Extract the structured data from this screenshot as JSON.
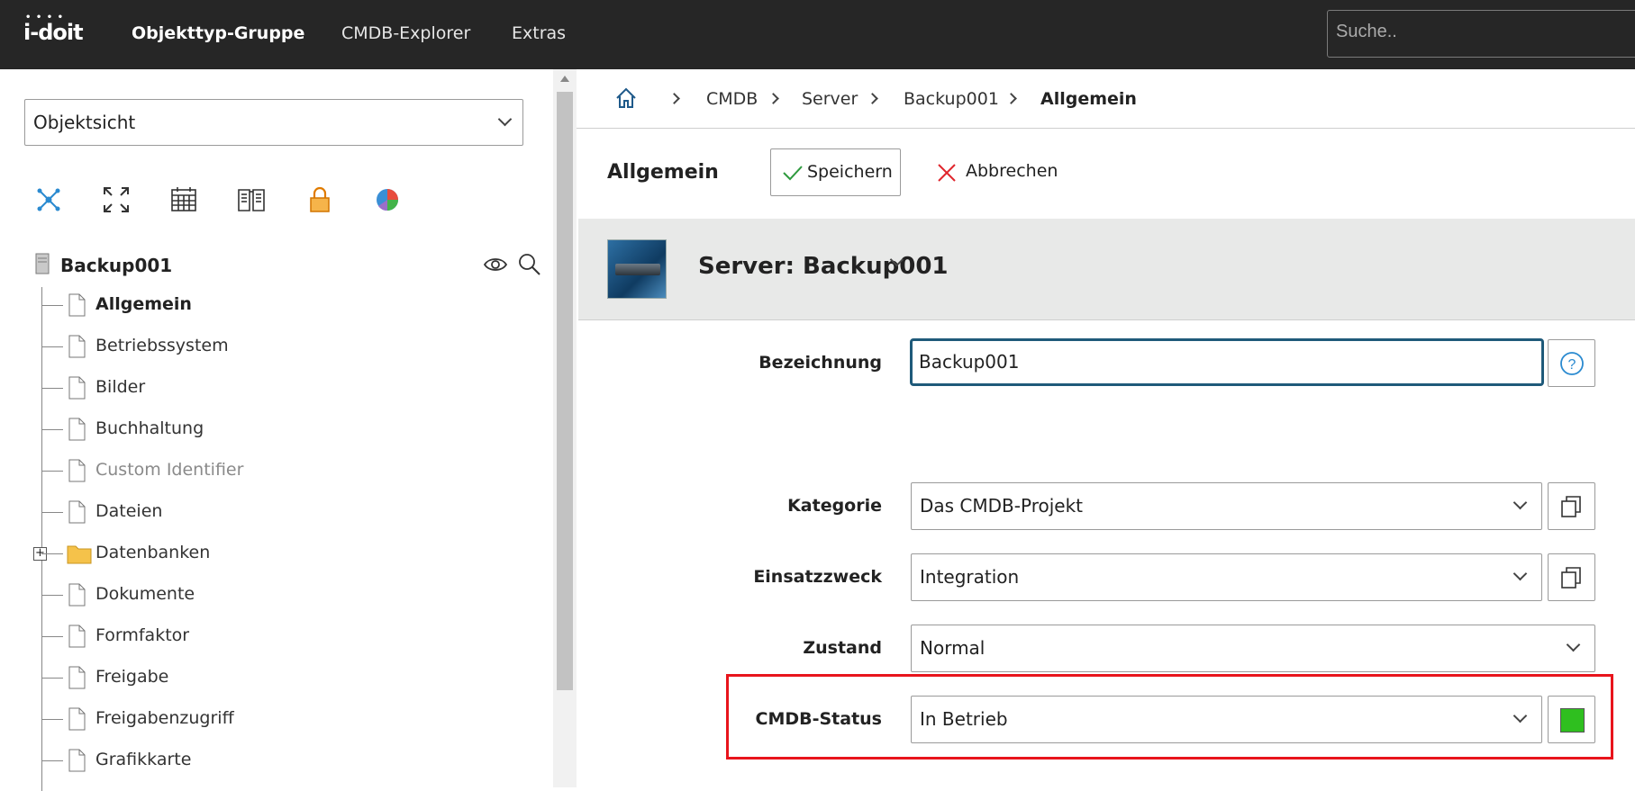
{
  "topbar": {
    "logo": "i-doit",
    "nav": [
      "Objekttyp-Gruppe",
      "CMDB-Explorer",
      "Extras"
    ],
    "search_placeholder": "Suche.."
  },
  "left": {
    "view_select": "Objektsicht",
    "toolbar_icons": [
      "network-icon",
      "expand-icon",
      "calendar-icon",
      "book-icon",
      "lock-icon",
      "pie-chart-icon"
    ],
    "root": "Backup001",
    "items": [
      "Allgemein",
      "Betriebssystem",
      "Bilder",
      "Buchhaltung",
      "Custom Identifier",
      "Dateien",
      "Datenbanken",
      "Dokumente",
      "Formfaktor",
      "Freigabe",
      "Freigabenzugriff",
      "Grafikkarte"
    ]
  },
  "breadcrumb": [
    "CMDB",
    "Server",
    "Backup001",
    "Allgemein"
  ],
  "actions": {
    "title": "Allgemein",
    "save": "Speichern",
    "cancel": "Abbrechen"
  },
  "object": {
    "title": "Server: Backup001"
  },
  "form": {
    "bezeichnung_label": "Bezeichnung",
    "bezeichnung_value": "Backup001",
    "kategorie_label": "Kategorie",
    "kategorie_value": "Das CMDB-Projekt",
    "einsatzzweck_label": "Einsatzzweck",
    "einsatzzweck_value": "Integration",
    "zustand_label": "Zustand",
    "zustand_value": "Normal",
    "cmdb_status_label": "CMDB-Status",
    "cmdb_status_value": "In Betrieb",
    "cmdb_status_color": "#2fbf1f"
  }
}
